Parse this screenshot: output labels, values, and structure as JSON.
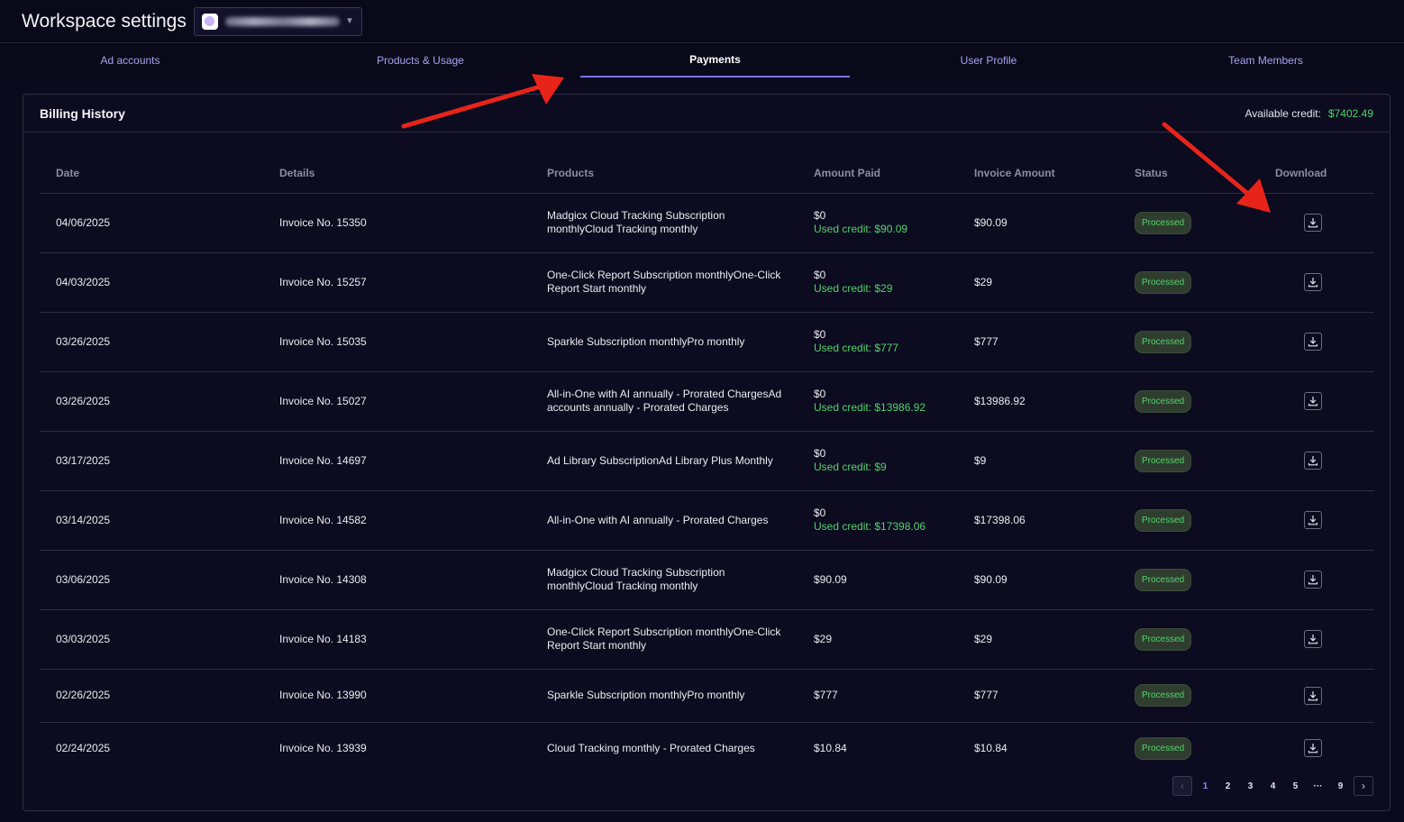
{
  "header": {
    "title": "Workspace settings"
  },
  "tabs": [
    {
      "label": "Ad accounts",
      "active": false
    },
    {
      "label": "Products & Usage",
      "active": false
    },
    {
      "label": "Payments",
      "active": true
    },
    {
      "label": "User Profile",
      "active": false
    },
    {
      "label": "Team Members",
      "active": false
    }
  ],
  "billing": {
    "title": "Billing History",
    "credit_label": "Available credit:",
    "credit_value": "$7402.49",
    "columns": [
      "Date",
      "Details",
      "Products",
      "Amount Paid",
      "Invoice Amount",
      "Status",
      "Download"
    ],
    "rows": [
      {
        "date": "04/06/2025",
        "details": "Invoice No. 15350",
        "products": "Madgicx Cloud Tracking Subscription monthlyCloud Tracking monthly",
        "paid": "$0",
        "used": "Used credit: $90.09",
        "invoice": "$90.09",
        "status": "Processed"
      },
      {
        "date": "04/03/2025",
        "details": "Invoice No. 15257",
        "products": "One-Click Report Subscription monthlyOne-Click Report Start monthly",
        "paid": "$0",
        "used": "Used credit: $29",
        "invoice": "$29",
        "status": "Processed"
      },
      {
        "date": "03/26/2025",
        "details": "Invoice No. 15035",
        "products": "Sparkle Subscription monthlyPro monthly",
        "paid": "$0",
        "used": "Used credit: $777",
        "invoice": "$777",
        "status": "Processed"
      },
      {
        "date": "03/26/2025",
        "details": "Invoice No. 15027",
        "products": "All-in-One with AI annually - Prorated ChargesAd accounts annually - Prorated Charges",
        "paid": "$0",
        "used": "Used credit: $13986.92",
        "invoice": "$13986.92",
        "status": "Processed"
      },
      {
        "date": "03/17/2025",
        "details": "Invoice No. 14697",
        "products": "Ad Library SubscriptionAd Library Plus Monthly",
        "paid": "$0",
        "used": "Used credit: $9",
        "invoice": "$9",
        "status": "Processed"
      },
      {
        "date": "03/14/2025",
        "details": "Invoice No. 14582",
        "products": "All-in-One with AI annually - Prorated Charges",
        "paid": "$0",
        "used": "Used credit: $17398.06",
        "invoice": "$17398.06",
        "status": "Processed"
      },
      {
        "date": "03/06/2025",
        "details": "Invoice No. 14308",
        "products": "Madgicx Cloud Tracking Subscription monthlyCloud Tracking monthly",
        "paid": "$90.09",
        "used": "",
        "invoice": "$90.09",
        "status": "Processed"
      },
      {
        "date": "03/03/2025",
        "details": "Invoice No. 14183",
        "products": "One-Click Report Subscription monthlyOne-Click Report Start monthly",
        "paid": "$29",
        "used": "",
        "invoice": "$29",
        "status": "Processed"
      },
      {
        "date": "02/26/2025",
        "details": "Invoice No. 13990",
        "products": "Sparkle Subscription monthlyPro monthly",
        "paid": "$777",
        "used": "",
        "invoice": "$777",
        "status": "Processed"
      },
      {
        "date": "02/24/2025",
        "details": "Invoice No. 13939",
        "products": "Cloud Tracking monthly - Prorated Charges",
        "paid": "$10.84",
        "used": "",
        "invoice": "$10.84",
        "status": "Processed"
      }
    ]
  },
  "pagination": {
    "prev": "‹",
    "next": "›",
    "pages": [
      "1",
      "2",
      "3",
      "4",
      "5",
      "···",
      "9"
    ],
    "active": "1"
  },
  "icons": {
    "download": "download-icon",
    "arrow": "red-annotation-arrow"
  },
  "colors": {
    "accent": "#7b74e8",
    "credit": "#52d36a",
    "annotation": "#e8241a"
  }
}
